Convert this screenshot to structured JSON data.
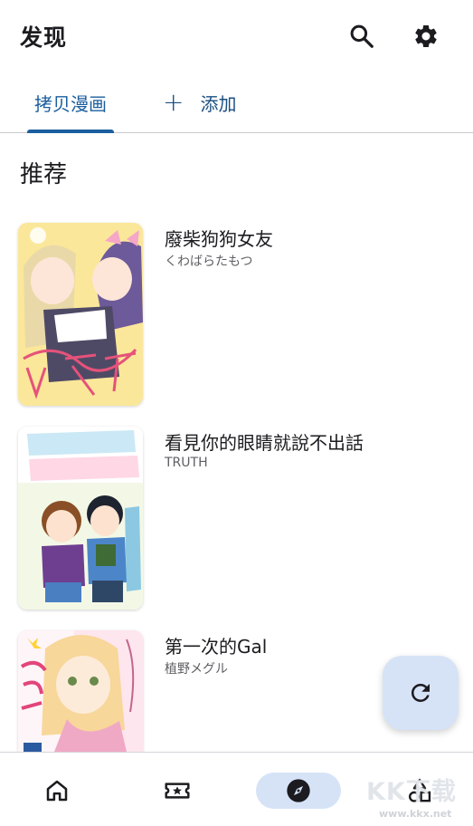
{
  "header": {
    "title": "发现",
    "search_icon": "search-icon",
    "settings_icon": "gear-icon"
  },
  "tabs": [
    {
      "label": "拷贝漫画",
      "selected": true
    },
    {
      "label": "添加",
      "icon": "plus-icon",
      "selected": false
    }
  ],
  "section": {
    "title": "推荐"
  },
  "items": [
    {
      "title": "廢柴狗狗女友",
      "author": "くわばらたもつ"
    },
    {
      "title": "看見你的眼睛就說不出話",
      "author": "TRUTH"
    },
    {
      "title": "第一次的Gal",
      "author": "植野メグル"
    }
  ],
  "fab": {
    "icon": "refresh-icon"
  },
  "bottom_nav": [
    {
      "icon": "home-icon",
      "active": false
    },
    {
      "icon": "ticket-star-icon",
      "active": false
    },
    {
      "icon": "compass-icon",
      "active": true
    },
    {
      "icon": "shapes-icon",
      "active": false
    }
  ],
  "watermark": {
    "logo": "KK下载",
    "url": "www.kkx.net"
  },
  "colors": {
    "accent": "#1b5e9e",
    "active_pill": "#d6e3f7",
    "divider": "#c9c9cf",
    "text": "#1c1b1f",
    "subtext": "#5f5f63"
  }
}
